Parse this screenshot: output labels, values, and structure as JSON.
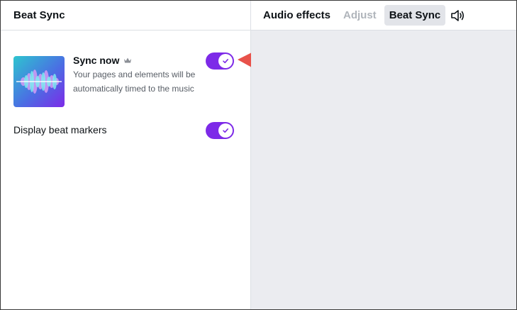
{
  "panel": {
    "title": "Beat Sync"
  },
  "toolbar": {
    "audio_effects": "Audio effects",
    "adjust": "Adjust",
    "beat_sync": "Beat Sync",
    "speaker_icon": "speaker-icon"
  },
  "sync_now": {
    "title": "Sync now",
    "description": "Your pages and elements will be automatically timed to the music",
    "enabled": true,
    "premium_icon": "crown-icon",
    "thumbnail_icon": "soundwave-icon"
  },
  "beat_markers": {
    "label": "Display beat markers",
    "enabled": true
  },
  "colors": {
    "accent": "#7d2ae8",
    "canvas_bg": "#ebecf0",
    "annotation_arrow": "#e8524a"
  }
}
